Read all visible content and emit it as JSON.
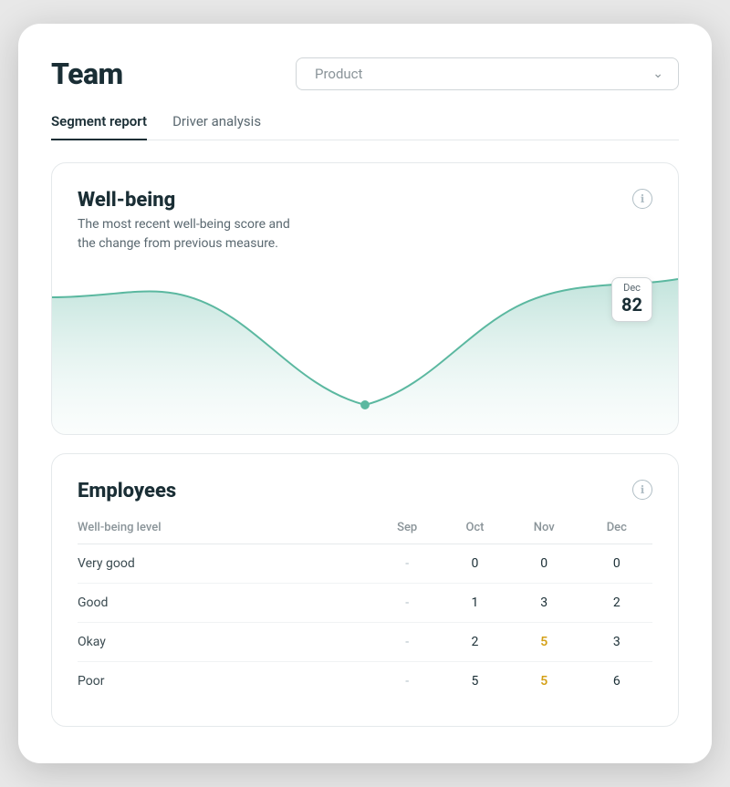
{
  "header": {
    "title": "Team",
    "dropdown": {
      "label": "Product",
      "placeholder": "Product"
    }
  },
  "tabs": [
    {
      "id": "segment-report",
      "label": "Segment report",
      "active": true
    },
    {
      "id": "driver-analysis",
      "label": "Driver analysis",
      "active": false
    }
  ],
  "wellbeing_card": {
    "title": "Well-being",
    "description_line1": "The most recent well-being score and",
    "description_line2": "the change from previous measure.",
    "info_icon": "ℹ",
    "tooltip": {
      "month": "Dec",
      "value": "82"
    },
    "chart": {
      "accent_color": "#5bb8a0",
      "fill_color_start": "#a8d8cd",
      "fill_color_end": "#e8f5f3"
    }
  },
  "employees_card": {
    "title": "Employees",
    "info_icon": "ℹ",
    "columns": [
      "Well-being level",
      "Sep",
      "Oct",
      "Nov",
      "Dec"
    ],
    "rows": [
      {
        "level": "Very good",
        "sep": "-",
        "oct": "0",
        "nov": "0",
        "dec": "0",
        "highlight_nov": false
      },
      {
        "level": "Good",
        "sep": "-",
        "oct": "1",
        "nov": "3",
        "dec": "2",
        "highlight_nov": false
      },
      {
        "level": "Okay",
        "sep": "-",
        "oct": "2",
        "nov": "5",
        "dec": "3",
        "highlight_nov": true
      },
      {
        "level": "Poor",
        "sep": "-",
        "oct": "5",
        "nov": "5",
        "dec": "6",
        "highlight_nov": true
      }
    ]
  }
}
